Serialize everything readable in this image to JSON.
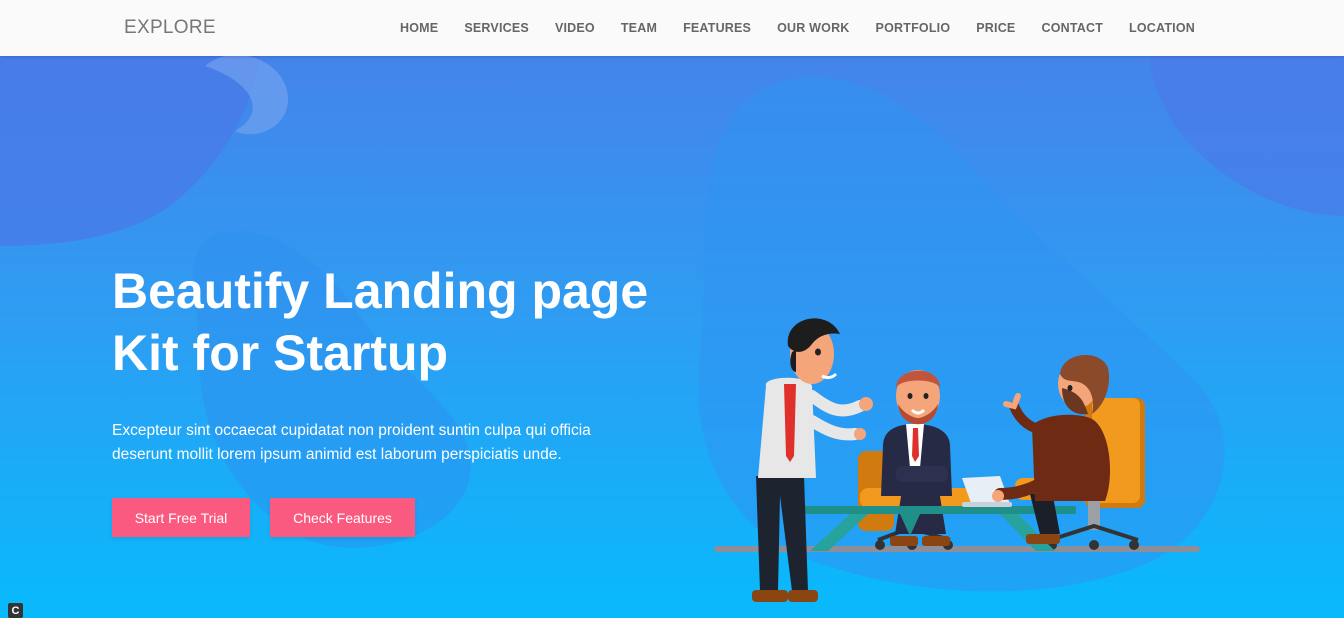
{
  "brand": "EXPLORE",
  "nav": {
    "home": "HOME",
    "services": "SERVICES",
    "video": "VIDEO",
    "team": "TEAM",
    "features": "FEATURES",
    "our_work": "OUR WORK",
    "portfolio": "PORTFOLIO",
    "price": "PRICE",
    "contact": "CONTACT",
    "location": "LOCATION"
  },
  "hero": {
    "title_line1": "Beautify Landing page",
    "title_line2": "Kit for Startup",
    "subtitle_line1": "Excepteur sint occaecat cupidatat non proident suntin culpa qui officia",
    "subtitle_line2": "deserunt mollit lorem ipsum animid est laborum perspiciatis unde.",
    "primary_button": "Start Free Trial",
    "secondary_button": "Check Features"
  },
  "illustration": {
    "icon": "business-meeting-illustration"
  },
  "corner_badge": {
    "icon": "c-badge-icon",
    "label": "C"
  },
  "colors": {
    "nav_background": "#fafafa",
    "hero_gradient_top": "#4484ea",
    "hero_gradient_bottom": "#08bafc",
    "button": "#fb5a80",
    "text_on_hero": "#ffffff"
  }
}
